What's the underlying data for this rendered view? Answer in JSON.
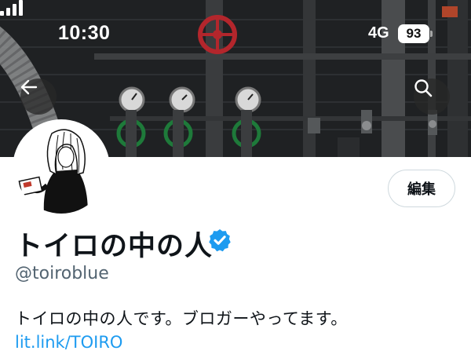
{
  "status_bar": {
    "time": "10:30",
    "network": "4G",
    "battery": "93"
  },
  "header": {
    "back_icon": "arrow-left-icon",
    "search_icon": "search-icon"
  },
  "profile": {
    "edit_label": "編集",
    "display_name": "トイロの中の人",
    "verified_icon": "verified-badge-icon",
    "verified_color": "#1d9bf0",
    "handle": "@toiroblue",
    "bio": "トイロの中の人です。ブロガーやってます。",
    "link": "lit.link/TOIRO"
  },
  "colors": {
    "link": "#1d9bf0",
    "secondary_text": "#536471",
    "primary_text": "#0f1419"
  }
}
